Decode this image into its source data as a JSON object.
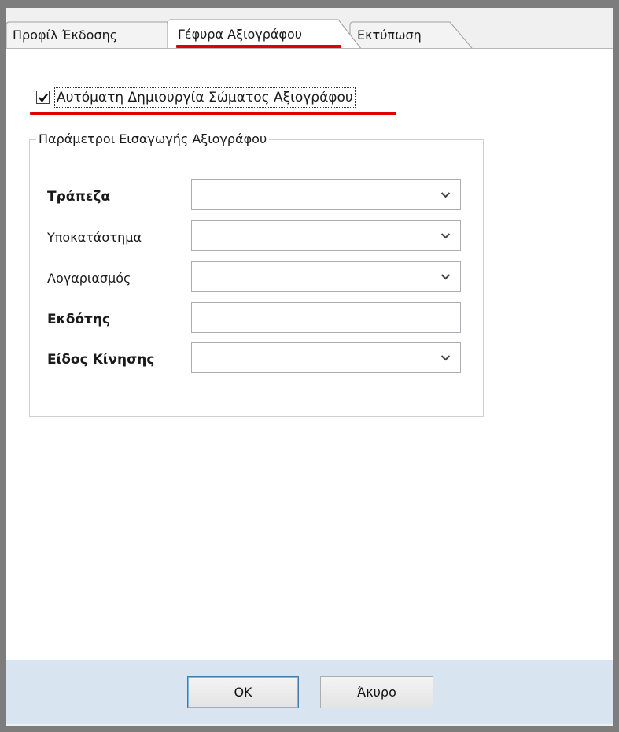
{
  "tabs": [
    {
      "label": "Προφίλ Έκδοσης",
      "active": false
    },
    {
      "label": "Γέφυρα Αξιογράφου",
      "active": true
    },
    {
      "label": "Εκτύπωση",
      "active": false
    }
  ],
  "auto_create": {
    "label": "Αυτόματη Δημιουργία Σώματος Αξιογράφου",
    "checked": true
  },
  "group": {
    "title": "Παράμετροι Εισαγωγής Αξιογράφου",
    "fields": [
      {
        "label": "Τράπεζα",
        "bold": true,
        "type": "combo",
        "value": ""
      },
      {
        "label": "Υποκατάστημα",
        "bold": false,
        "type": "combo",
        "value": ""
      },
      {
        "label": "Λογαριασμός",
        "bold": false,
        "type": "combo",
        "value": ""
      },
      {
        "label": "Εκδότης",
        "bold": true,
        "type": "text",
        "value": ""
      },
      {
        "label": "Είδος Κίνησης",
        "bold": true,
        "type": "combo",
        "value": ""
      }
    ]
  },
  "buttons": {
    "ok": "OK",
    "cancel": "Άκυρο"
  },
  "colors": {
    "highlight_underline": "#e00000",
    "footer_bg": "#d9e4f1"
  }
}
